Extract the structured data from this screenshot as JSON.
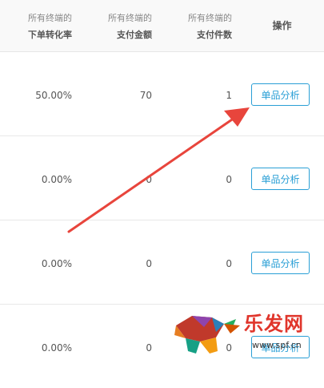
{
  "header": {
    "col1": {
      "line1": "所有终端的",
      "line2": "下单转化率"
    },
    "col2": {
      "line1": "所有终端的",
      "line2": "支付金额"
    },
    "col3": {
      "line1": "所有终端的",
      "line2": "支付件数"
    },
    "col4": "操作"
  },
  "rows": [
    {
      "rate": "50.00%",
      "amount": "70",
      "count": "1",
      "action": "单品分析"
    },
    {
      "rate": "0.00%",
      "amount": "0",
      "count": "0",
      "action": "单品分析"
    },
    {
      "rate": "0.00%",
      "amount": "0",
      "count": "0",
      "action": "单品分析"
    },
    {
      "rate": "0.00%",
      "amount": "0",
      "count": "0",
      "action": "单品分析"
    }
  ],
  "watermark": {
    "name": "乐发网",
    "url": "www.spf.cn"
  },
  "colors": {
    "accent": "#2a9fd6",
    "arrow": "#e8453c",
    "logo": "#e0352b"
  }
}
